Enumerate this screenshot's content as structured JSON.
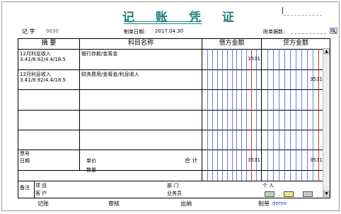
{
  "title": "记 账 凭 证",
  "header": {
    "word_label": "记 字",
    "word_number": "0030",
    "date_label": "制单日期:",
    "date_value": "2017.04.30",
    "attachments_label": "附单据数:"
  },
  "columns": {
    "summary": "摘 要",
    "account": "科目名称",
    "debit": "借方金额",
    "credit": "贷方金额"
  },
  "rows": [
    {
      "summary_1": "12月利息收入",
      "summary_2": "3.41/8.92/4.4/18.5",
      "account": "银行存款/金筹金",
      "debit": "3531",
      "credit": ""
    },
    {
      "summary_1": "12月利息收入",
      "summary_2": "3.41/8.92/4.4/18.5",
      "account": "财务费用/金筹金/利息收入",
      "debit": "",
      "credit": "3531"
    }
  ],
  "footer": {
    "ticket_label": "票号",
    "date_label": "日期",
    "unit_price_label": "单价",
    "quantity_label": "数量",
    "total_label": "合 计",
    "total_debit": "3531",
    "total_credit": "3531",
    "note_label": "备注",
    "project_label": "项 目",
    "dept_label": "部 门",
    "person_label": "个 人",
    "customer_label": "客 户",
    "salesman_label": "业务员"
  },
  "signatures": {
    "bookkeeper": "记账",
    "reviewer": "审核",
    "cashier": "出纳",
    "maker_label": "制单",
    "maker_value": "demo"
  },
  "icons": {
    "attachment": "magnifier-icon",
    "colors": {
      "title": "#1f8080",
      "debit_line": "#c0392b",
      "grid_blue": "#3b4fd1"
    }
  }
}
